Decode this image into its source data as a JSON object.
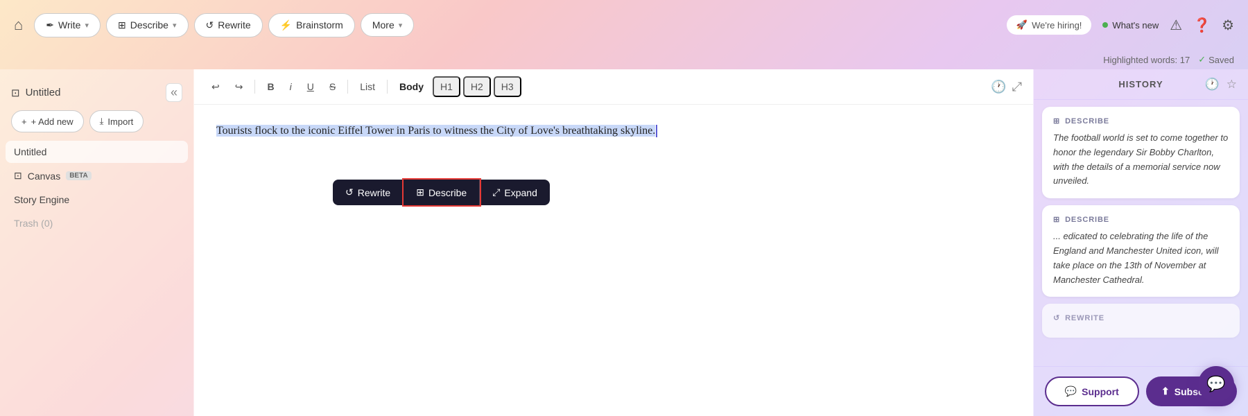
{
  "topnav": {
    "home_icon": "🏠",
    "write_label": "Write",
    "describe_label": "Describe",
    "rewrite_label": "Rewrite",
    "brainstorm_label": "Brainstorm",
    "more_label": "More",
    "hiring_label": "We're hiring!",
    "whats_new_label": "What's new",
    "highlight_label": "Highlighted words: 17",
    "saved_label": "Saved"
  },
  "sidebar": {
    "title": "Untitled",
    "add_new_label": "+ Add new",
    "import_label": "Import",
    "items": [
      {
        "id": "untitled",
        "label": "Untitled",
        "icon": "",
        "active": true
      },
      {
        "id": "canvas",
        "label": "Canvas",
        "icon": "⊡",
        "badge": "BETA"
      },
      {
        "id": "story-engine",
        "label": "Story Engine",
        "icon": ""
      },
      {
        "id": "trash",
        "label": "Trash (0)",
        "icon": "",
        "muted": true
      }
    ]
  },
  "editor": {
    "toolbar": {
      "undo": "↩",
      "redo": "↪",
      "bold": "B",
      "italic": "I",
      "underline": "U",
      "strikethrough": "S",
      "list": "List",
      "body": "Body",
      "h1": "H1",
      "h2": "H2",
      "h3": "H3"
    },
    "content": "Tourists flock to the iconic Eiffel Tower in Paris to witness the City of Love's breathtaking skyline."
  },
  "floating_toolbar": {
    "rewrite_label": "Rewrite",
    "describe_label": "Describe",
    "expand_label": "Expand"
  },
  "history_panel": {
    "title": "HISTORY",
    "cards": [
      {
        "type": "DESCRIBE",
        "text": "The football world is set to come together to honor the legendary Sir Bobby Charlton, with the details of a memorial service now unveiled."
      },
      {
        "type": "DESCRIBE",
        "text": "... edicated to celebrating the life of the England and Manchester United icon, will take place on the 13th of November at Manchester Cathedral."
      },
      {
        "type": "REWRITE",
        "text": "",
        "partial": true
      }
    ]
  },
  "footer": {
    "support_label": "Support",
    "subscribe_label": "Subscribe"
  }
}
